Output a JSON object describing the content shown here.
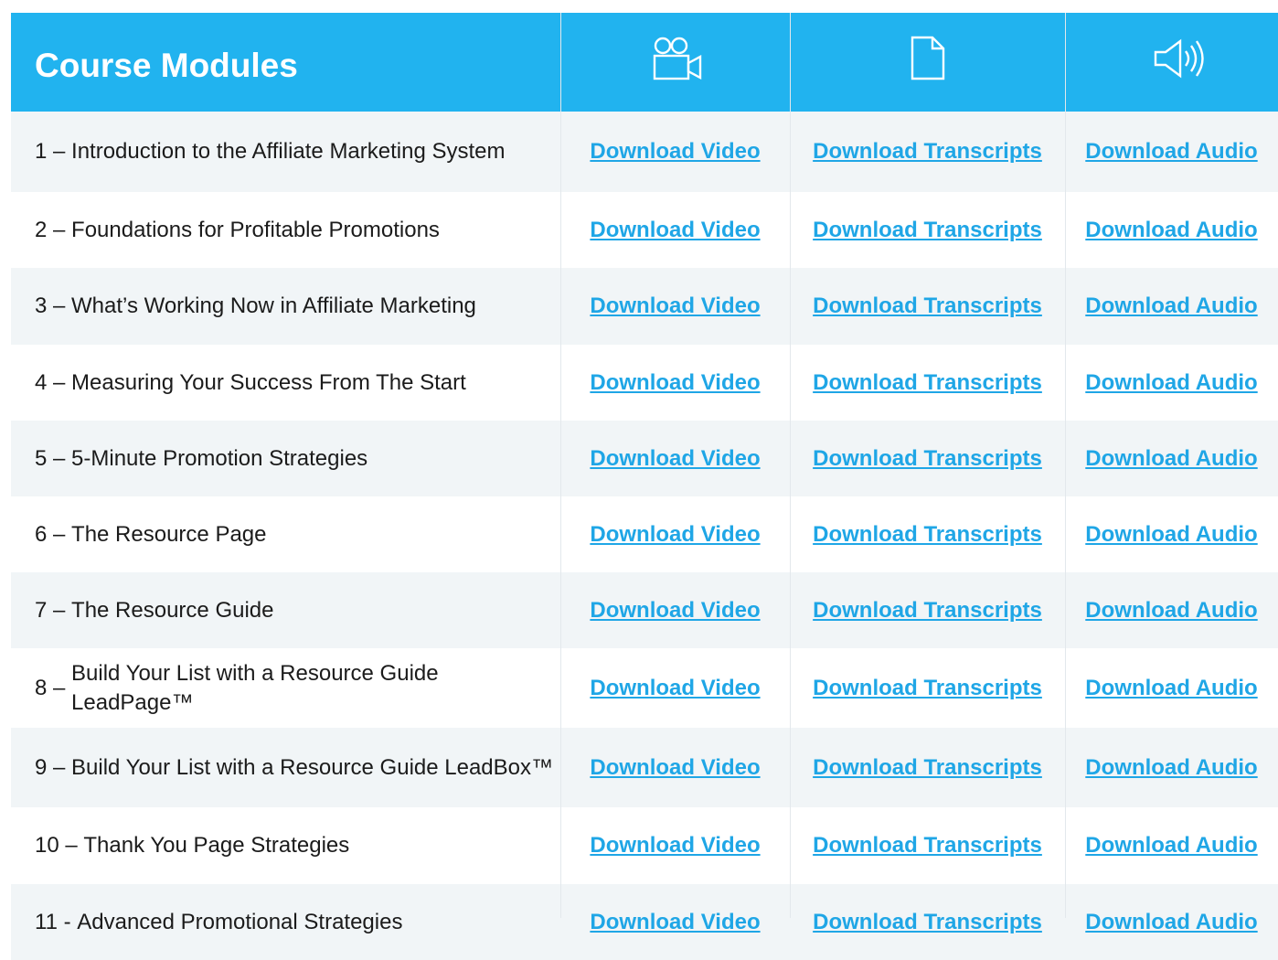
{
  "header": {
    "title": "Course Modules",
    "icons": [
      "video-camera-icon",
      "document-icon",
      "speaker-icon"
    ],
    "colors": {
      "header_bg": "#21b3ef",
      "link": "#1fa6e6",
      "alt_row": "#f1f5f7"
    }
  },
  "link_labels": {
    "video": "Download Video",
    "transcripts": "Download Transcripts",
    "audio": "Download Audio"
  },
  "modules": [
    {
      "num": "1 – ",
      "title": "Introduction to the Affiliate Marketing System"
    },
    {
      "num": "2 – ",
      "title": "Foundations for Profitable Promotions"
    },
    {
      "num": "3 – ",
      "title": "What’s Working Now in Affiliate Marketing"
    },
    {
      "num": "4 – ",
      "title": "Measuring Your Success From The Start"
    },
    {
      "num": "5 – ",
      "title": "5-Minute Promotion Strategies"
    },
    {
      "num": "6 – ",
      "title": "The Resource Page"
    },
    {
      "num": "7 – ",
      "title": "The Resource Guide"
    },
    {
      "num": "8 – ",
      "title": "Build Your List with a Resource Guide LeadPage™"
    },
    {
      "num": "9 – ",
      "title": "Build Your List with a Resource Guide LeadBox™"
    },
    {
      "num": "10 – ",
      "title": "Thank You Page Strategies"
    },
    {
      "num": "11 - ",
      "title": "Advanced Promotional Strategies"
    }
  ]
}
